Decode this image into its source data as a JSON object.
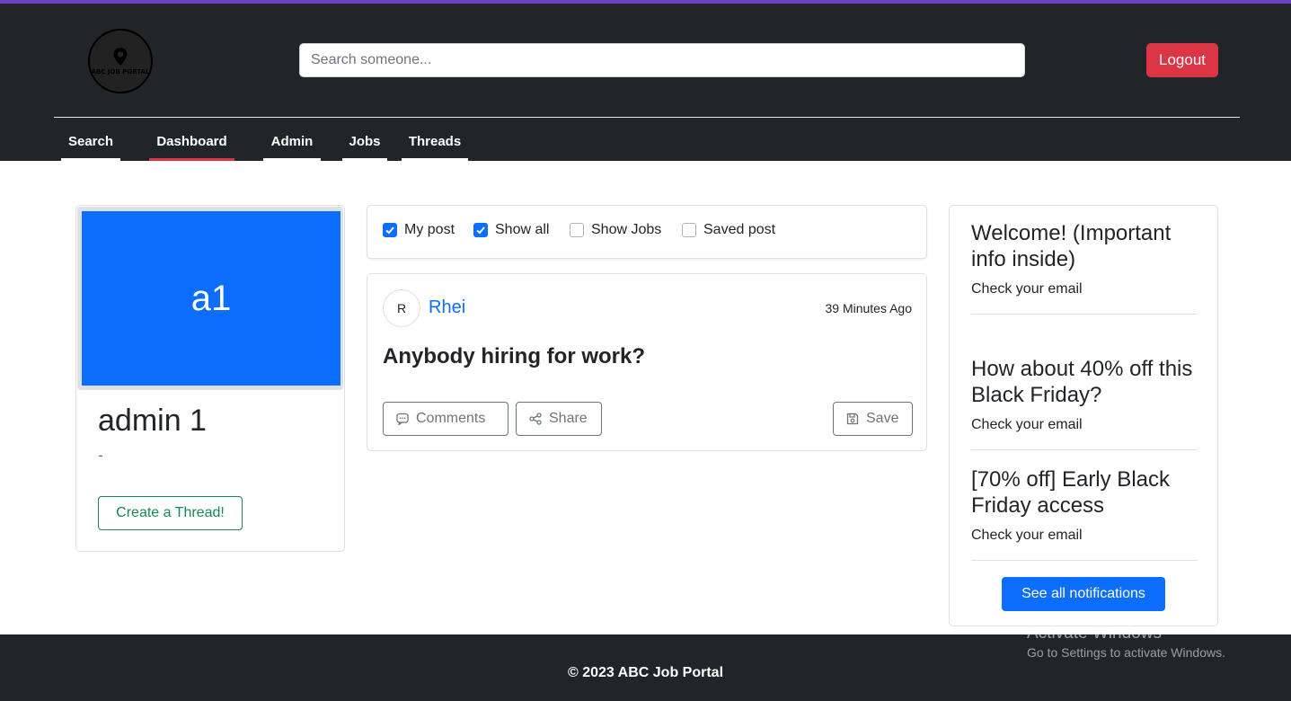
{
  "header": {
    "logo_text": "ABC JOB PORTAL",
    "search_placeholder": "Search someone...",
    "search_value": "",
    "logout_label": "Logout"
  },
  "nav": {
    "items": [
      {
        "label": "Search"
      },
      {
        "label": "Dashboard"
      },
      {
        "label": "Admin"
      },
      {
        "label": "Jobs"
      },
      {
        "label": "Threads"
      }
    ],
    "active": "Dashboard"
  },
  "profile": {
    "initials": "a1",
    "name": "admin 1",
    "subtitle": "-",
    "create_thread_label": "Create a Thread!"
  },
  "filters": [
    {
      "label": "My post",
      "checked": true
    },
    {
      "label": "Show all",
      "checked": true
    },
    {
      "label": "Show Jobs",
      "checked": false
    },
    {
      "label": "Saved post",
      "checked": false
    }
  ],
  "post": {
    "avatar_initial": "R",
    "author": "Rhei",
    "time": "39 Minutes Ago",
    "title": "Anybody hiring for work?",
    "comments_label": "Comments",
    "share_label": "Share",
    "save_label": "Save"
  },
  "notifications": {
    "items": [
      {
        "title": "Welcome! (Important info inside)",
        "text": "Check your email"
      },
      {
        "title": "How about 40% off this Black Friday?",
        "text": "Check your email"
      },
      {
        "title": "[70% off] Early Black Friday access",
        "text": "Check your email"
      }
    ],
    "see_all_label": "See all notifications"
  },
  "footer": {
    "text": "© 2023 ABC Job Portal"
  },
  "watermark": {
    "line1": "Activate Windows",
    "line2": "Go to Settings to activate Windows."
  },
  "colors": {
    "header_bg": "#212529",
    "primary": "#0d6efd",
    "danger": "#dc3545",
    "success": "#198754"
  }
}
